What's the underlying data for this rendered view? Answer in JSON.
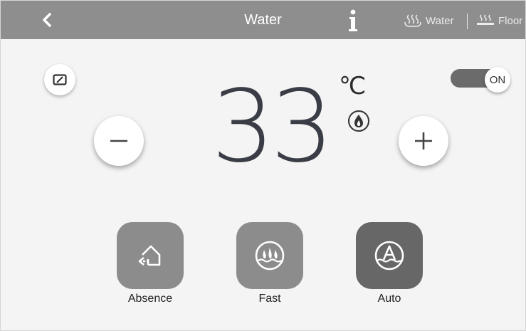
{
  "header": {
    "title": "Water",
    "info_icon": "info-icon",
    "back_icon": "chevron-left-icon",
    "tabs": [
      {
        "label": "Water",
        "icon": "water-heating-icon"
      },
      {
        "label": "Floor",
        "icon": "floor-heating-icon"
      }
    ]
  },
  "controls": {
    "edit_icon": "edit-card-icon",
    "power_toggle": "ON",
    "minus_icon": "minus-icon",
    "plus_icon": "plus-icon"
  },
  "temperature": {
    "value": "33",
    "unit": "℃",
    "status_icon": "flame-icon"
  },
  "modes": [
    {
      "label": "Absence",
      "icon": "absence-house-icon"
    },
    {
      "label": "Fast",
      "icon": "fast-heat-icon"
    },
    {
      "label": "Auto",
      "icon": "auto-mode-icon"
    }
  ],
  "colors": {
    "header_bg": "#8e8e8e",
    "background": "#f4f4f4",
    "mode_button": "#8c8c8c",
    "mode_button_active": "#676767",
    "temperature_text": "#3a3d46"
  }
}
